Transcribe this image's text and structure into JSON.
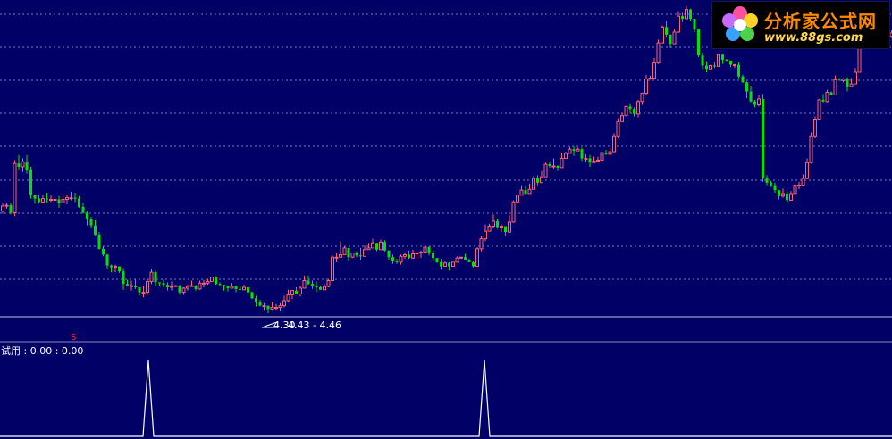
{
  "app": {
    "watermark": {
      "title": "分析家公式网",
      "url": "www.88gs.com"
    }
  },
  "main_chart": {
    "low_marker": "4.30",
    "range_label": "4.43 - 4.46",
    "signal_char": "S"
  },
  "sub_chart": {
    "indicator_label": "试用 : 0.00 : 0.00"
  },
  "colors": {
    "background": "#000066",
    "up": "#ff5f6e",
    "down": "#00e400",
    "grid": "#7777bb",
    "text": "#ffffff",
    "signal": "#ff2222"
  },
  "chart_data": {
    "type": "candlestick",
    "x_start": 3,
    "x_step": 4.5,
    "y_range": [
      4.3,
      8.0
    ],
    "candles": [
      [
        5.53,
        5.59,
        5.62,
        5.5
      ],
      [
        5.59,
        5.6,
        5.63,
        5.56
      ],
      [
        5.6,
        5.51,
        5.63,
        5.49
      ],
      [
        5.51,
        6.1,
        6.14,
        5.47
      ],
      [
        6.1,
        6.06,
        6.2,
        6.03
      ],
      [
        6.06,
        6.12,
        6.16,
        6.0
      ],
      [
        6.12,
        6.02,
        6.2,
        5.98
      ],
      [
        6.02,
        5.72,
        6.06,
        5.68
      ],
      [
        5.72,
        5.68,
        5.72,
        5.62
      ],
      [
        5.68,
        5.64,
        5.73,
        5.62
      ],
      [
        5.64,
        5.68,
        5.73,
        5.63
      ],
      [
        5.68,
        5.67,
        5.75,
        5.63
      ],
      [
        5.67,
        5.67,
        5.72,
        5.64
      ],
      [
        5.67,
        5.67,
        5.74,
        5.66
      ],
      [
        5.67,
        5.63,
        5.71,
        5.57
      ],
      [
        5.63,
        5.67,
        5.72,
        5.63
      ],
      [
        5.67,
        5.69,
        5.72,
        5.61
      ],
      [
        5.69,
        5.69,
        5.76,
        5.66
      ],
      [
        5.69,
        5.68,
        5.75,
        5.64
      ],
      [
        5.68,
        5.58,
        5.71,
        5.57
      ],
      [
        5.58,
        5.51,
        5.63,
        5.5
      ],
      [
        5.51,
        5.44,
        5.53,
        5.36
      ],
      [
        5.44,
        5.36,
        5.46,
        5.33
      ],
      [
        5.36,
        5.25,
        5.42,
        5.24
      ],
      [
        5.25,
        5.08,
        5.28,
        5.07
      ],
      [
        5.08,
        5.01,
        5.11,
        4.99
      ],
      [
        5.01,
        4.88,
        5.02,
        4.84
      ],
      [
        4.88,
        4.86,
        4.89,
        4.8
      ],
      [
        4.86,
        4.87,
        4.89,
        4.8
      ],
      [
        4.87,
        4.81,
        4.87,
        4.79
      ],
      [
        4.81,
        4.66,
        4.85,
        4.59
      ],
      [
        4.66,
        4.64,
        4.71,
        4.63
      ],
      [
        4.64,
        4.64,
        4.7,
        4.58
      ],
      [
        4.64,
        4.62,
        4.71,
        4.6
      ],
      [
        4.62,
        4.56,
        4.62,
        4.52
      ],
      [
        4.56,
        4.56,
        4.63,
        4.5
      ],
      [
        4.56,
        4.69,
        4.71,
        4.53
      ],
      [
        4.69,
        4.8,
        4.84,
        4.66
      ],
      [
        4.8,
        4.68,
        4.82,
        4.64
      ],
      [
        4.68,
        4.67,
        4.67,
        4.63
      ],
      [
        4.67,
        4.65,
        4.71,
        4.62
      ],
      [
        4.65,
        4.62,
        4.68,
        4.58
      ],
      [
        4.62,
        4.63,
        4.69,
        4.58
      ],
      [
        4.63,
        4.64,
        4.64,
        4.64
      ],
      [
        4.64,
        4.56,
        4.65,
        4.53
      ],
      [
        4.56,
        4.61,
        4.62,
        4.53
      ],
      [
        4.61,
        4.63,
        4.65,
        4.58
      ],
      [
        4.63,
        4.64,
        4.7,
        4.63
      ],
      [
        4.64,
        4.6,
        4.65,
        4.58
      ],
      [
        4.6,
        4.67,
        4.7,
        4.59
      ],
      [
        4.67,
        4.67,
        4.71,
        4.62
      ],
      [
        4.67,
        4.69,
        4.72,
        4.65
      ],
      [
        4.69,
        4.74,
        4.74,
        4.71
      ],
      [
        4.74,
        4.66,
        4.75,
        4.65
      ],
      [
        4.66,
        4.65,
        4.68,
        4.64
      ],
      [
        4.65,
        4.64,
        4.65,
        4.58
      ],
      [
        4.64,
        4.61,
        4.64,
        4.57
      ],
      [
        4.61,
        4.63,
        4.67,
        4.61
      ],
      [
        4.63,
        4.6,
        4.63,
        4.56
      ],
      [
        4.6,
        4.59,
        4.64,
        4.59
      ],
      [
        4.59,
        4.62,
        4.65,
        4.59
      ],
      [
        4.62,
        4.56,
        4.62,
        4.54
      ],
      [
        4.56,
        4.49,
        4.57,
        4.48
      ],
      [
        4.49,
        4.45,
        4.52,
        4.39
      ],
      [
        4.45,
        4.4,
        4.47,
        4.39
      ],
      [
        4.4,
        4.4,
        4.43,
        4.35
      ],
      [
        4.4,
        4.36,
        4.4,
        4.31
      ],
      [
        4.36,
        4.38,
        4.44,
        4.35
      ],
      [
        4.38,
        4.38,
        4.42,
        4.35
      ],
      [
        4.38,
        4.4,
        4.43,
        4.34
      ],
      [
        4.4,
        4.46,
        4.52,
        4.38
      ],
      [
        4.46,
        4.53,
        4.59,
        4.44
      ],
      [
        4.53,
        4.58,
        4.59,
        4.48
      ],
      [
        4.58,
        4.54,
        4.62,
        4.54
      ],
      [
        4.54,
        4.61,
        4.63,
        4.51
      ],
      [
        4.61,
        4.7,
        4.76,
        4.66
      ],
      [
        4.7,
        4.66,
        4.76,
        4.65
      ],
      [
        4.66,
        4.64,
        4.7,
        4.6
      ],
      [
        4.64,
        4.62,
        4.69,
        4.56
      ],
      [
        4.62,
        4.59,
        4.64,
        4.59
      ],
      [
        4.59,
        4.63,
        4.66,
        4.6
      ],
      [
        4.63,
        4.7,
        4.72,
        4.62
      ],
      [
        4.7,
        4.98,
        5.0,
        4.69
      ],
      [
        4.98,
        4.98,
        5.03,
        4.92
      ],
      [
        4.98,
        5.01,
        5.17,
        5.01
      ],
      [
        5.01,
        5.09,
        5.11,
        5.04
      ],
      [
        5.09,
        4.98,
        5.09,
        4.94
      ],
      [
        4.98,
        5.03,
        5.03,
        4.97
      ],
      [
        5.03,
        5.0,
        5.05,
        4.98
      ],
      [
        5.0,
        4.99,
        5.09,
        4.95
      ],
      [
        4.99,
        5.07,
        5.12,
        5.05
      ],
      [
        5.07,
        5.09,
        5.15,
        5.07
      ],
      [
        5.09,
        5.15,
        5.2,
        5.09
      ],
      [
        5.15,
        5.07,
        5.15,
        5.05
      ],
      [
        5.07,
        5.16,
        5.19,
        5.07
      ],
      [
        5.16,
        5.06,
        5.18,
        5.05
      ],
      [
        5.06,
        4.98,
        5.06,
        4.95
      ],
      [
        4.98,
        4.94,
        5.01,
        4.9
      ],
      [
        4.94,
        4.92,
        4.96,
        4.9
      ],
      [
        4.92,
        4.99,
        5.01,
        4.89
      ],
      [
        4.99,
        5.01,
        5.04,
        4.96
      ],
      [
        5.01,
        4.97,
        5.06,
        4.96
      ],
      [
        4.97,
        5.02,
        5.07,
        4.96
      ],
      [
        5.02,
        5.03,
        5.05,
        4.96
      ],
      [
        5.03,
        5.04,
        5.06,
        4.97
      ],
      [
        5.04,
        5.1,
        5.12,
        5.01
      ],
      [
        5.1,
        5.03,
        5.11,
        5.0
      ],
      [
        5.03,
        4.97,
        5.06,
        4.94
      ],
      [
        4.97,
        4.92,
        4.97,
        4.91
      ],
      [
        4.92,
        4.87,
        4.96,
        4.83
      ],
      [
        4.87,
        4.91,
        4.94,
        4.88
      ],
      [
        4.91,
        4.87,
        4.92,
        4.82
      ],
      [
        4.87,
        4.92,
        4.92,
        4.87
      ],
      [
        4.92,
        4.97,
        4.99,
        4.92
      ],
      [
        4.97,
        4.98,
        4.98,
        4.96
      ],
      [
        4.98,
        4.95,
        5.02,
        4.95
      ],
      [
        4.95,
        4.92,
        4.96,
        4.92
      ],
      [
        4.92,
        4.87,
        4.94,
        4.86
      ],
      [
        4.87,
        5.08,
        5.1,
        4.87
      ],
      [
        5.08,
        5.2,
        5.23,
        5.05
      ],
      [
        5.2,
        5.29,
        5.37,
        5.17
      ],
      [
        5.29,
        5.35,
        5.38,
        5.34
      ],
      [
        5.35,
        5.41,
        5.49,
        5.33
      ],
      [
        5.41,
        5.34,
        5.44,
        5.32
      ],
      [
        5.34,
        5.35,
        5.37,
        5.28
      ],
      [
        5.35,
        5.28,
        5.35,
        5.24
      ],
      [
        5.28,
        5.4,
        5.48,
        5.27
      ],
      [
        5.4,
        5.64,
        5.66,
        5.39
      ],
      [
        5.64,
        5.72,
        5.73,
        5.64
      ],
      [
        5.72,
        5.78,
        5.84,
        5.72
      ],
      [
        5.78,
        5.74,
        5.84,
        5.73
      ],
      [
        5.74,
        5.79,
        5.86,
        5.77
      ],
      [
        5.79,
        5.92,
        5.95,
        5.79
      ],
      [
        5.92,
        5.87,
        5.96,
        5.84
      ],
      [
        5.87,
        5.94,
        6.01,
        5.88
      ],
      [
        5.94,
        6.09,
        6.11,
        5.95
      ],
      [
        6.09,
        6.07,
        6.12,
        6.05
      ],
      [
        6.07,
        6.07,
        6.16,
        6.04
      ],
      [
        6.07,
        6.05,
        6.08,
        6.01
      ],
      [
        6.05,
        6.16,
        6.23,
        6.06
      ],
      [
        6.16,
        6.22,
        6.24,
        6.19
      ],
      [
        6.22,
        6.27,
        6.3,
        6.27
      ],
      [
        6.27,
        6.25,
        6.3,
        6.19
      ],
      [
        6.25,
        6.27,
        6.29,
        6.25
      ],
      [
        6.27,
        6.16,
        6.29,
        6.13
      ],
      [
        6.16,
        6.16,
        6.21,
        6.12
      ],
      [
        6.16,
        6.11,
        6.2,
        6.06
      ],
      [
        6.11,
        6.13,
        6.18,
        6.11
      ],
      [
        6.13,
        6.14,
        6.18,
        6.14
      ],
      [
        6.14,
        6.23,
        6.25,
        6.18
      ],
      [
        6.23,
        6.21,
        6.26,
        6.2
      ],
      [
        6.21,
        6.24,
        6.29,
        6.18
      ],
      [
        6.24,
        6.43,
        6.46,
        6.25
      ],
      [
        6.43,
        6.6,
        6.64,
        6.4
      ],
      [
        6.6,
        6.67,
        6.7,
        6.61
      ],
      [
        6.67,
        6.78,
        6.79,
        6.76
      ],
      [
        6.78,
        6.75,
        6.82,
        6.7
      ],
      [
        6.75,
        6.69,
        6.77,
        6.66
      ],
      [
        6.69,
        6.84,
        6.86,
        6.65
      ],
      [
        6.84,
        6.94,
        6.94,
        6.8
      ],
      [
        6.94,
        7.11,
        7.16,
        6.91
      ],
      [
        7.11,
        7.12,
        7.15,
        7.1
      ],
      [
        7.12,
        7.3,
        7.36,
        7.12
      ],
      [
        7.3,
        7.54,
        7.58,
        7.29
      ],
      [
        7.54,
        7.73,
        7.75,
        7.54
      ],
      [
        7.73,
        7.64,
        7.8,
        7.61
      ],
      [
        7.64,
        7.53,
        7.64,
        7.48
      ],
      [
        7.53,
        7.67,
        7.7,
        7.54
      ],
      [
        7.67,
        7.86,
        7.92,
        7.66
      ],
      [
        7.86,
        7.83,
        7.9,
        7.79
      ],
      [
        7.83,
        7.94,
        7.98,
        7.94
      ],
      [
        7.94,
        7.83,
        7.95,
        7.81
      ],
      [
        7.83,
        7.7,
        7.83,
        7.67
      ],
      [
        7.7,
        7.39,
        7.7,
        7.37
      ],
      [
        7.39,
        7.27,
        7.43,
        7.23
      ],
      [
        7.27,
        7.23,
        7.32,
        7.19
      ],
      [
        7.23,
        7.27,
        7.28,
        7.25
      ],
      [
        7.27,
        7.26,
        7.31,
        7.24
      ],
      [
        7.26,
        7.4,
        7.41,
        7.28
      ],
      [
        7.4,
        7.34,
        7.41,
        7.29
      ],
      [
        7.34,
        7.33,
        7.35,
        7.32
      ],
      [
        7.33,
        7.28,
        7.33,
        7.25
      ],
      [
        7.28,
        7.28,
        7.29,
        7.24
      ],
      [
        7.28,
        7.14,
        7.31,
        7.12
      ],
      [
        7.14,
        7.07,
        7.16,
        7.06
      ],
      [
        7.07,
        6.96,
        7.08,
        6.88
      ],
      [
        6.96,
        6.84,
        7.03,
        6.83
      ],
      [
        6.84,
        6.8,
        6.86,
        6.77
      ],
      [
        6.8,
        6.87,
        6.92,
        6.78
      ],
      [
        6.87,
        5.92,
        6.93,
        5.88
      ],
      [
        5.92,
        5.87,
        5.96,
        5.84
      ],
      [
        5.87,
        5.84,
        5.89,
        5.82
      ],
      [
        5.84,
        5.78,
        5.87,
        5.75
      ],
      [
        5.78,
        5.71,
        5.78,
        5.67
      ],
      [
        5.71,
        5.74,
        5.8,
        5.69
      ],
      [
        5.74,
        5.66,
        5.76,
        5.64
      ],
      [
        5.66,
        5.74,
        5.77,
        5.72
      ],
      [
        5.74,
        5.84,
        5.86,
        5.72
      ],
      [
        5.84,
        5.84,
        5.88,
        5.79
      ],
      [
        5.84,
        5.92,
        5.97,
        5.89
      ],
      [
        5.92,
        6.11,
        6.16,
        5.91
      ],
      [
        6.11,
        6.43,
        6.47,
        6.1
      ],
      [
        6.43,
        6.63,
        6.66,
        6.4
      ],
      [
        6.63,
        6.86,
        6.87,
        6.63
      ],
      [
        6.86,
        6.84,
        6.93,
        6.83
      ],
      [
        6.84,
        6.95,
        6.98,
        6.83
      ],
      [
        6.95,
        6.92,
        6.96,
        6.92
      ],
      [
        6.92,
        7.1,
        7.15,
        6.92
      ],
      [
        7.1,
        7.09,
        7.12,
        7.1
      ],
      [
        7.09,
        7.11,
        7.12,
        7.07
      ],
      [
        7.11,
        7.02,
        7.13,
        6.96
      ],
      [
        7.02,
        7.05,
        7.12,
        7.02
      ],
      [
        7.05,
        7.19,
        7.24,
        7.06
      ],
      [
        7.19,
        7.56,
        7.61,
        7.2
      ],
      [
        7.56,
        7.53,
        7.59,
        7.53
      ],
      [
        7.53,
        7.66,
        7.7,
        7.57
      ],
      [
        7.66,
        7.75,
        7.77,
        7.73
      ],
      [
        7.75,
        7.71,
        7.8,
        7.69
      ],
      [
        7.71,
        7.66,
        7.77,
        7.61
      ],
      [
        7.66,
        7.64,
        7.67,
        7.57
      ],
      [
        7.64,
        7.62,
        7.68,
        7.53
      ],
      [
        7.62,
        7.66,
        7.69,
        7.6
      ],
      [
        7.66,
        7.65,
        7.69,
        7.63
      ]
    ],
    "sub_peaks_x": [
      166,
      542
    ]
  }
}
